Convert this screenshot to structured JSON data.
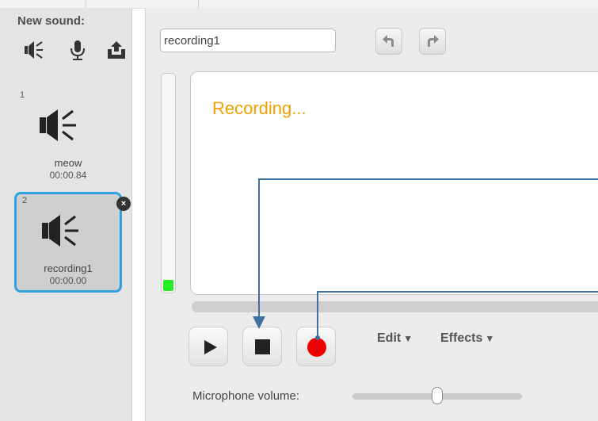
{
  "sidebar": {
    "title": "New sound:",
    "icons": [
      "speaker-library-icon",
      "microphone-icon",
      "upload-icon"
    ],
    "sounds": [
      {
        "number": "1",
        "name": "meow",
        "duration": "00:00.84",
        "selected": false
      },
      {
        "number": "2",
        "name": "recording1",
        "duration": "00:00.00",
        "selected": true
      }
    ],
    "delete_symbol": "×"
  },
  "editor": {
    "sound_name": "recording1",
    "status_text": "Recording...",
    "level_meter_fraction": 0.05,
    "edit_menu": "Edit",
    "effects_menu": "Effects",
    "caret": "▼",
    "mic_volume_label": "Microphone volume:",
    "mic_volume_fraction": 0.5
  },
  "colors": {
    "selection_border": "#2ea3df",
    "status_text": "#f0a000",
    "record_dot": "#ee0000",
    "level_meter": "#22ee22",
    "annotation_arrow": "#3f6f9f"
  }
}
